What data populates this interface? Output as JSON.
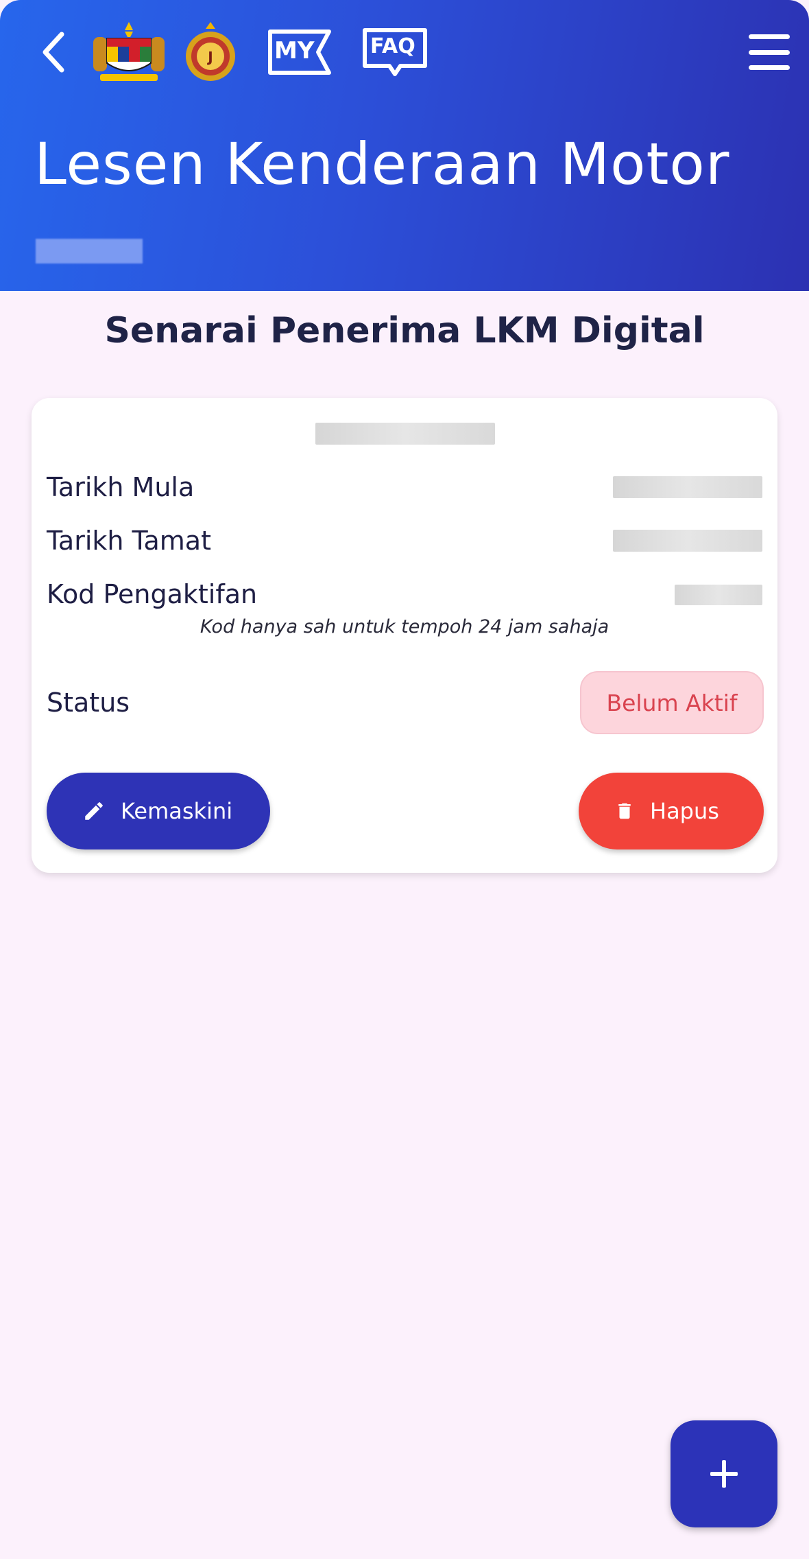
{
  "header": {
    "title": "Lesen Kenderaan Motor",
    "my_label": "MY",
    "faq_label": "FAQ"
  },
  "section_title": "Senarai Penerima LKM Digital",
  "card": {
    "start_date_label": "Tarikh Mula",
    "end_date_label": "Tarikh Tamat",
    "activation_code_label": "Kod Pengaktifan",
    "activation_note": "Kod hanya sah untuk tempoh 24 jam sahaja",
    "status_label": "Status",
    "status_value": "Belum Aktif",
    "edit_button": "Kemaskini",
    "delete_button": "Hapus"
  },
  "colors": {
    "header_start": "#2766ec",
    "header_end": "#2c31b2",
    "primary": "#2e33b6",
    "danger": "#f2433a",
    "status_bg": "#fdd5dc",
    "status_text": "#d9434f",
    "page_bg": "#fcf1fc"
  },
  "icons": [
    "back-arrow-icon",
    "malaysia-crest-icon",
    "jpj-crest-icon",
    "my-icon",
    "faq-icon",
    "hamburger-menu-icon",
    "pencil-icon",
    "trash-icon",
    "plus-icon"
  ]
}
